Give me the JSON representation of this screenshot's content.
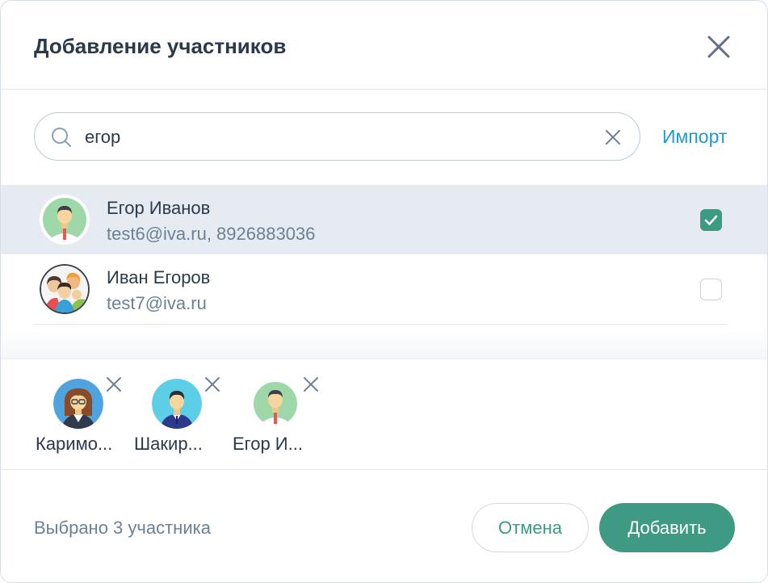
{
  "dialog": {
    "title": "Добавление участников",
    "close_icon": "close-icon"
  },
  "search": {
    "value": "егор",
    "placeholder": "",
    "search_icon": "search-icon",
    "clear_icon": "clear-icon",
    "import_label": "Импорт"
  },
  "results": [
    {
      "name": "Егор Иванов",
      "contact": "test6@iva.ru, 8926883036",
      "checked": true,
      "avatar": "man-green-avatar"
    },
    {
      "name": "Иван Егоров",
      "contact": "test7@iva.ru",
      "checked": false,
      "avatar": "group-avatar"
    }
  ],
  "selected": [
    {
      "name": "Каримо...",
      "avatar": "woman-glasses-avatar"
    },
    {
      "name": "Шакир...",
      "avatar": "man-suit-avatar"
    },
    {
      "name": "Егор И...",
      "avatar": "man-green-avatar"
    }
  ],
  "footer": {
    "count_text": "Выбрано 3 участника",
    "cancel_label": "Отмена",
    "add_label": "Добавить"
  },
  "colors": {
    "accent": "#3f9a84",
    "link": "#1e9ad6",
    "selected_row": "#e6ebf2"
  }
}
